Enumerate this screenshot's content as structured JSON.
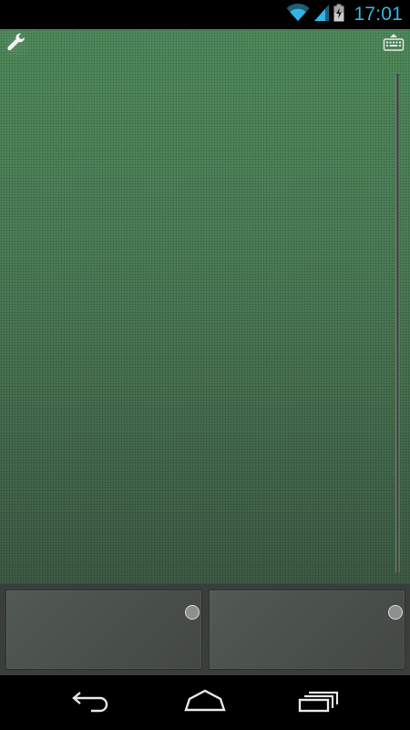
{
  "status_bar": {
    "time": "17:01",
    "icons": [
      "wifi-icon",
      "signal-icon",
      "battery-charging-icon"
    ],
    "accent_color": "#33b5e5"
  },
  "touchpad": {
    "background_color": "#4d8058",
    "icons": [
      "wrench-icon",
      "keyboard-icon"
    ]
  },
  "mouse_buttons": {
    "items": [
      "left",
      "right"
    ],
    "background_color": "#4a504b"
  },
  "navigation_bar": {
    "icons": [
      "back-icon",
      "home-icon",
      "recents-icon"
    ]
  }
}
